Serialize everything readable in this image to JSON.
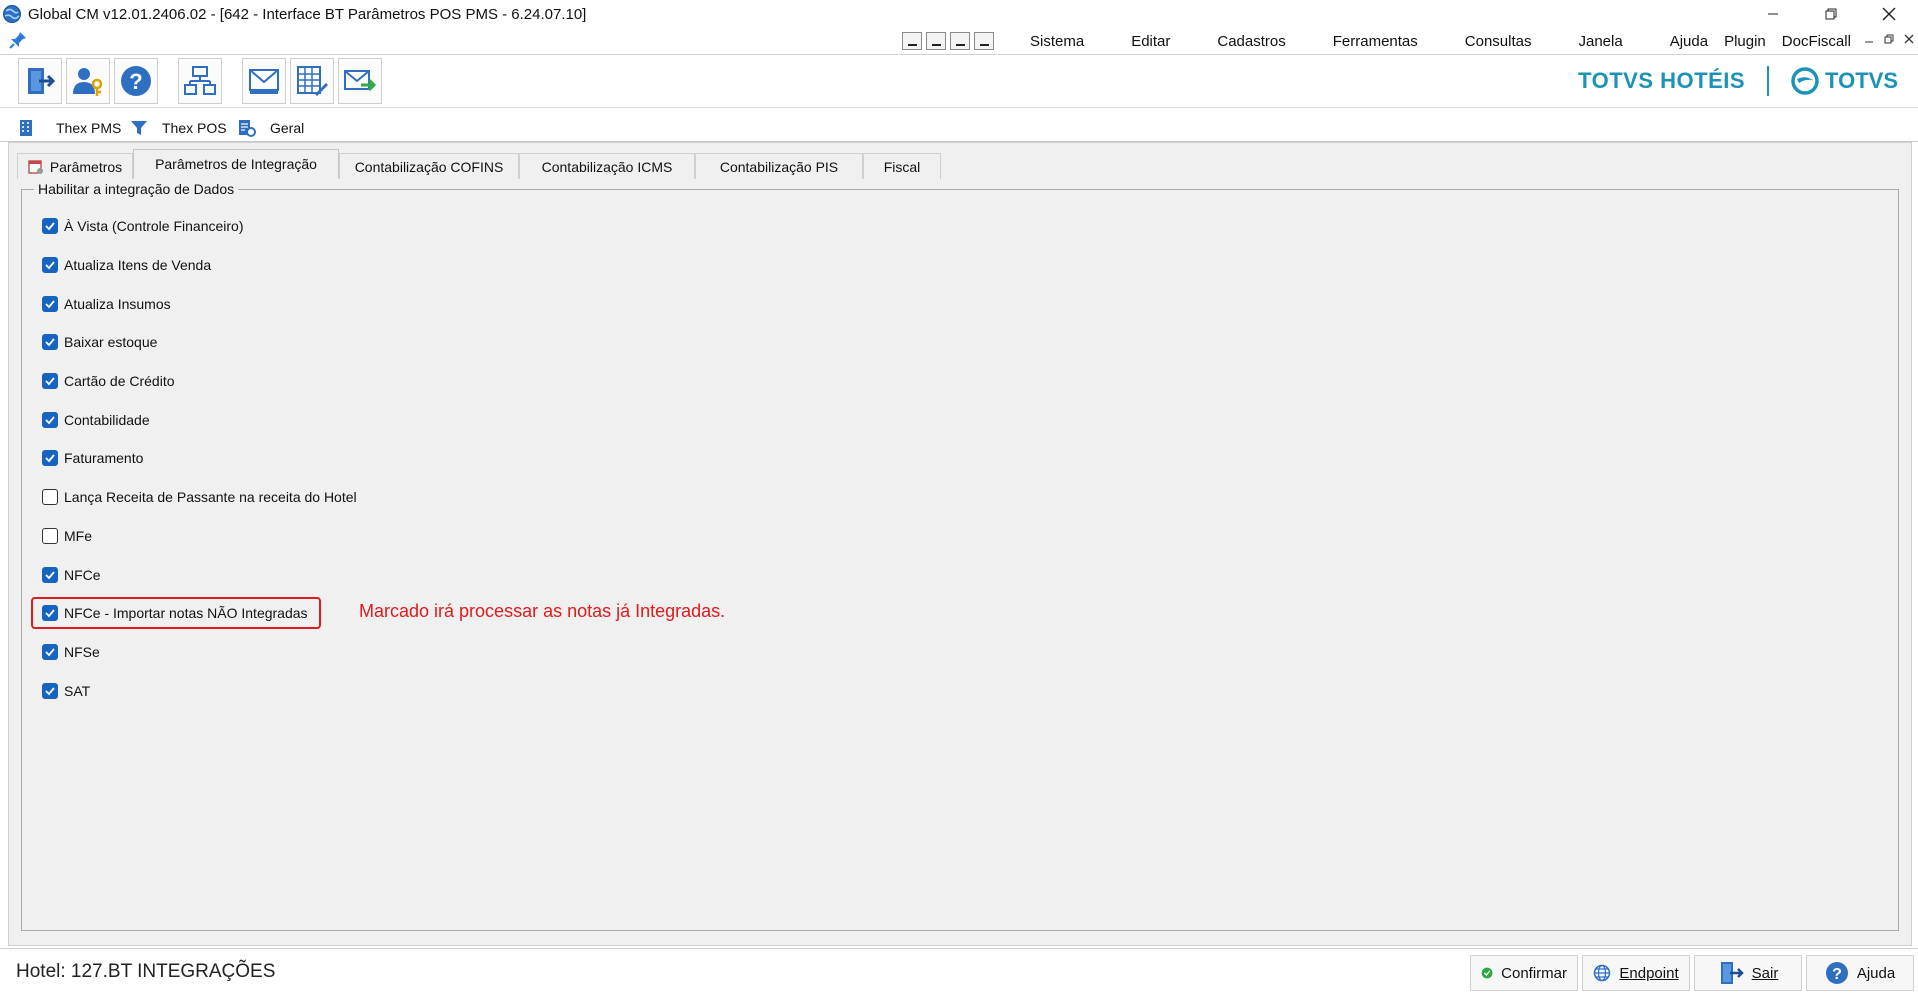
{
  "window": {
    "title": "Global CM v12.01.2406.02 - [642 - Interface BT Parâmetros POS PMS - 6.24.07.10]"
  },
  "menu": {
    "items": [
      "Sistema",
      "Editar",
      "Cadastros",
      "Ferramentas",
      "Consultas",
      "Janela",
      "Ajuda",
      "Plugin",
      "DocFiscall"
    ]
  },
  "brand": {
    "left": "TOTVS HOTÉIS",
    "right": "TOTVS",
    "color": "#1b93b6"
  },
  "main_tabs": [
    {
      "label": "Thex PMS",
      "icon": "building-icon"
    },
    {
      "label": "Thex POS",
      "icon": "filter-icon"
    },
    {
      "label": "Geral",
      "icon": "document-settings-icon"
    }
  ],
  "sub_tabs": [
    {
      "label": "Parâmetros"
    },
    {
      "label": "Parâmetros de Integração"
    },
    {
      "label": "Contabilização COFINS"
    },
    {
      "label": "Contabilização ICMS"
    },
    {
      "label": "Contabilização PIS"
    },
    {
      "label": "Fiscal"
    }
  ],
  "group": {
    "title": "Habilitar a integração de Dados",
    "options": [
      {
        "label": "À Vista (Controle Financeiro)",
        "checked": true
      },
      {
        "label": "Atualiza Itens de Venda",
        "checked": true
      },
      {
        "label": "Atualiza Insumos",
        "checked": true
      },
      {
        "label": "Baixar estoque",
        "checked": true
      },
      {
        "label": "Cartão de Crédito",
        "checked": true
      },
      {
        "label": "Contabilidade",
        "checked": true
      },
      {
        "label": "Faturamento",
        "checked": true
      },
      {
        "label": "Lança Receita de Passante na receita do Hotel",
        "checked": false
      },
      {
        "label": "MFe",
        "checked": false
      },
      {
        "label": "NFCe",
        "checked": true
      },
      {
        "label": "NFCe - Importar notas NÃO Integradas",
        "checked": true
      },
      {
        "label": "NFSe",
        "checked": true
      },
      {
        "label": "SAT",
        "checked": true
      }
    ]
  },
  "annotation": {
    "text": "Marcado irá processar as notas já Integradas.",
    "color": "#e01b1b"
  },
  "status": {
    "hotel": "Hotel: 127.BT INTEGRAÇÕES"
  },
  "footer_buttons": {
    "confirm": "Confirmar",
    "endpoint": "Endpoint",
    "exit": "Sair",
    "help": "Ajuda"
  }
}
